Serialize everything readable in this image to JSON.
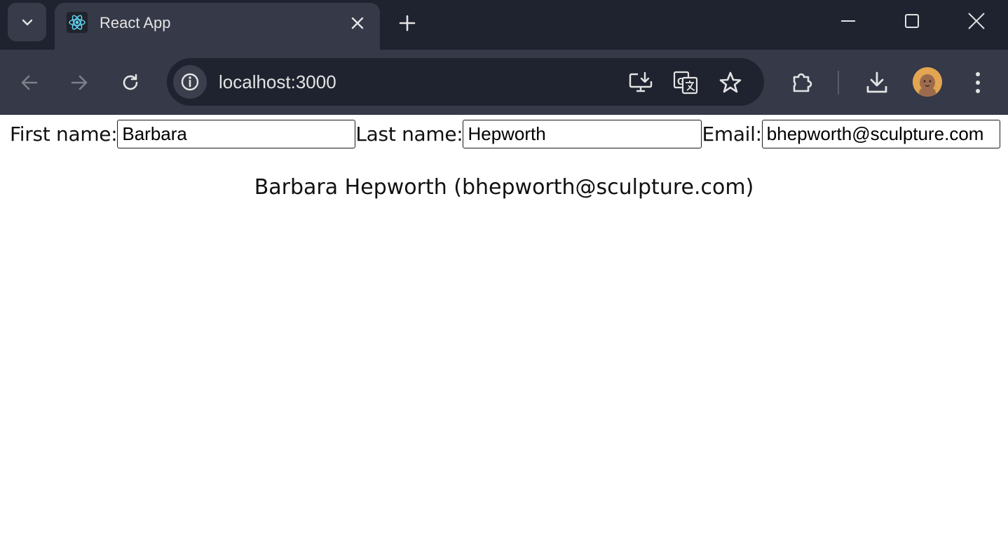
{
  "browser": {
    "tab": {
      "title": "React App",
      "favicon": "react-logo-icon"
    },
    "address_bar": {
      "url": "localhost:3000"
    },
    "icons": {
      "tab_search": "chevron-down-icon",
      "tab_close": "close-icon",
      "new_tab": "plus-icon",
      "minimize": "minimize-icon",
      "maximize": "maximize-icon",
      "close_window": "close-icon",
      "back": "arrow-left-icon",
      "forward": "arrow-right-icon",
      "reload": "reload-icon",
      "site_info": "info-icon",
      "install_app": "install-app-icon",
      "translate": "translate-icon",
      "bookmark": "star-icon",
      "extensions": "puzzle-icon",
      "downloads": "download-icon",
      "profile": "avatar",
      "menu": "kebab-menu-icon"
    },
    "colors": {
      "titlebar": "#1f2330",
      "toolbar": "#353948",
      "text": "#e3e3e3"
    }
  },
  "form": {
    "first_name": {
      "label": "First name:",
      "value": "Barbara"
    },
    "last_name": {
      "label": "Last name:",
      "value": "Hepworth"
    },
    "email": {
      "label": "Email:",
      "value": "bhepworth@sculpture.com"
    }
  },
  "summary": "Barbara Hepworth (bhepworth@sculpture.com)"
}
